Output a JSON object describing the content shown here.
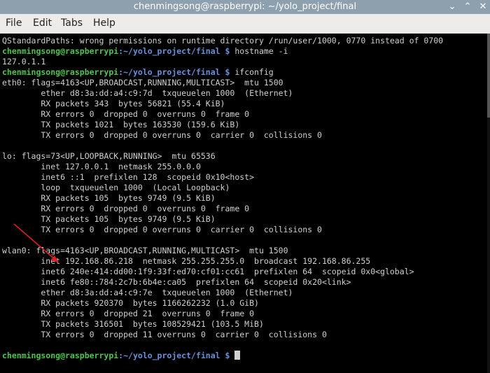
{
  "window": {
    "title": "chenmingsong@raspberrypi: ~/yolo_project/final",
    "minimize_glyph": "⌄",
    "maximize_glyph": "⌃",
    "close_glyph": "✕"
  },
  "menu": [
    "File",
    "Edit",
    "Tabs",
    "Help"
  ],
  "prompt": {
    "user": "chenmingsong@raspberrypi",
    "path": ":~/yolo_project/final $ "
  },
  "lines": [
    "QStandardPaths: wrong permissions on runtime directory /run/user/1000, 0770 instead of 0700",
    "hostname -i",
    "127.0.1.1",
    "ifconfig",
    "eth0: flags=4163<UP,BROADCAST,RUNNING,MULTICAST>  mtu 1500",
    "        ether d8:3a:dd:a4:c9:7d  txqueuelen 1000  (Ethernet)",
    "        RX packets 343  bytes 56821 (55.4 KiB)",
    "        RX errors 0  dropped 0  overruns 0  frame 0",
    "        TX packets 1021  bytes 163530 (159.6 KiB)",
    "        TX errors 0  dropped 0 overruns 0  carrier 0  collisions 0",
    "",
    "lo: flags=73<UP,LOOPBACK,RUNNING>  mtu 65536",
    "        inet 127.0.0.1  netmask 255.0.0.0",
    "        inet6 ::1  prefixlen 128  scopeid 0x10<host>",
    "        loop  txqueuelen 1000  (Local Loopback)",
    "        RX packets 105  bytes 9749 (9.5 KiB)",
    "        RX errors 0  dropped 0  overruns 0  frame 0",
    "        TX packets 105  bytes 9749 (9.5 KiB)",
    "        TX errors 0  dropped 0 overruns 0  carrier 0  collisions 0",
    "",
    "wlan0: flags=4163<UP,BROADCAST,RUNNING,MULTICAST>  mtu 1500",
    "        inet 192.168.86.218  netmask 255.255.255.0  broadcast 192.168.86.255",
    "        inet6 240e:414:dd00:1f9:33f:ed70:cf01:cc61  prefixlen 64  scopeid 0x0<global>",
    "        inet6 fe80::784:2c7b:6b4e:ca05  prefixlen 64  scopeid 0x20<link>",
    "        ether d8:3a:dd:a4:c9:7e  txqueuelen 1000  (Ethernet)",
    "        RX packets 920370  bytes 1166262232 (1.0 GiB)",
    "        RX errors 0  dropped 21  overruns 0  frame 0",
    "        TX packets 316501  bytes 108529421 (103.5 MiB)",
    "        TX errors 0  dropped 11 overruns 0  carrier 0  collisions 0",
    "",
    ""
  ],
  "colors": {
    "annotation_arrow": "#e02020",
    "prompt_user": "#4ec44e",
    "prompt_path": "#6a8fd8"
  }
}
